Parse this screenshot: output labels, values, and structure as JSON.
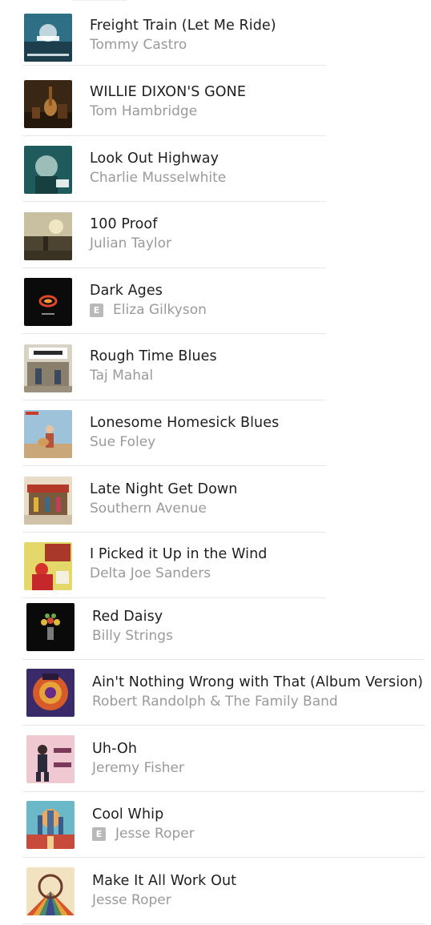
{
  "tracks": [
    {
      "title": "Freight Train (Let Me Ride)",
      "artist": "Tommy Castro",
      "explicit": false,
      "art_icon": "album-art-tommy-castro"
    },
    {
      "title": "WILLIE DIXON'S GONE",
      "artist": "Tom Hambridge",
      "explicit": false,
      "art_icon": "album-art-tom-hambridge"
    },
    {
      "title": "Look Out Highway",
      "artist": "Charlie Musselwhite",
      "explicit": false,
      "art_icon": "album-art-charlie-musselwhite"
    },
    {
      "title": "100 Proof",
      "artist": "Julian Taylor",
      "explicit": false,
      "art_icon": "album-art-julian-taylor"
    },
    {
      "title": "Dark Ages",
      "artist": "Eliza Gilkyson",
      "explicit": true,
      "explicit_label": "E",
      "art_icon": "album-art-eliza-gilkyson"
    },
    {
      "title": "Rough Time Blues",
      "artist": "Taj Mahal",
      "explicit": false,
      "art_icon": "album-art-taj-mahal"
    },
    {
      "title": "Lonesome Homesick Blues",
      "artist": "Sue Foley",
      "explicit": false,
      "art_icon": "album-art-sue-foley"
    },
    {
      "title": "Late Night Get Down",
      "artist": "Southern Avenue",
      "explicit": false,
      "art_icon": "album-art-southern-avenue"
    },
    {
      "title": "I Picked it Up in the Wind",
      "artist": "Delta Joe Sanders",
      "explicit": false,
      "art_icon": "album-art-delta-joe-sanders"
    },
    {
      "title": "Red Daisy",
      "artist": "Billy Strings",
      "explicit": false,
      "art_icon": "album-art-billy-strings"
    },
    {
      "title": "Ain't Nothing Wrong with That (Album Version)",
      "artist": "Robert Randolph & The Family Band",
      "explicit": false,
      "art_icon": "album-art-robert-randolph"
    },
    {
      "title": "Uh-Oh",
      "artist": "Jeremy Fisher",
      "explicit": false,
      "art_icon": "album-art-jeremy-fisher"
    },
    {
      "title": "Cool Whip",
      "artist": "Jesse Roper",
      "explicit": true,
      "explicit_label": "E",
      "art_icon": "album-art-jesse-roper-cool-whip"
    },
    {
      "title": "Make It All Work Out",
      "artist": "Jesse Roper",
      "explicit": false,
      "art_icon": "album-art-jesse-roper-make-it-all-work-out"
    }
  ]
}
